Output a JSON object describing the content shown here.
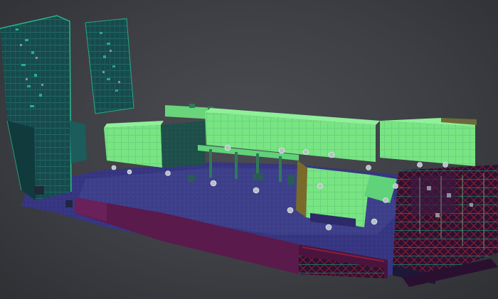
{
  "viewer": {
    "palette": {
      "background": "#45474c",
      "floor_high": "#3b3e86",
      "floor_mid": "#35337a",
      "floor_low": "#2f2a6a",
      "wall_magenta": "#5a1a4c",
      "wall_dark": "#3a0f34",
      "tower_teal": "#174a4c",
      "tower_teal_dark": "#103a3c",
      "tower_edge": "#2bd39a",
      "green_bright": "#7ce885",
      "green_mid": "#5fd27a",
      "green_shadow": "#2f7a55",
      "sphere": "#b7c0c8",
      "truss_red": "#8a1f33",
      "truss_teal": "#1f6a66"
    }
  }
}
